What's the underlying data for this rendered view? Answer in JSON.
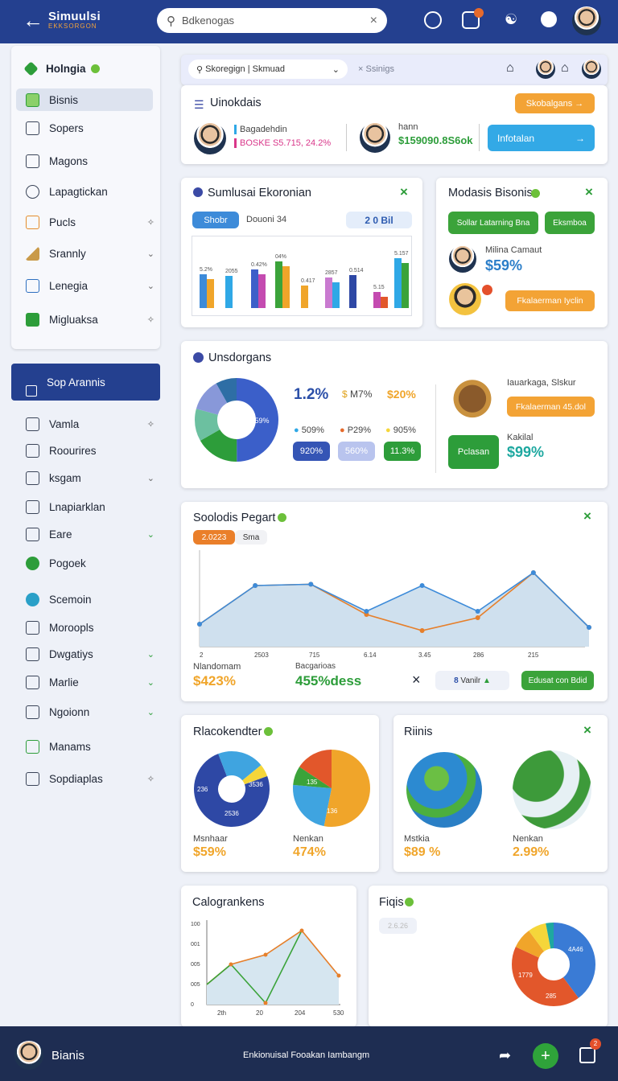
{
  "header": {
    "title": "Simuulsi",
    "subtitle": "EKKSORGON",
    "search_placeholder": "Bdkenogas"
  },
  "sidebar": {
    "items": [
      {
        "label": "Holngia",
        "icon": "diamond-icon"
      },
      {
        "label": "Bisnis",
        "icon": "pencil-icon"
      },
      {
        "label": "Sopers",
        "icon": "book-icon"
      },
      {
        "label": "Magons",
        "icon": "document-icon"
      },
      {
        "label": "Lapagtickan",
        "icon": "clock-icon"
      },
      {
        "label": "Pucls",
        "icon": "chart-icon"
      },
      {
        "label": "Srannly",
        "icon": "warning-icon"
      },
      {
        "label": "Lenegia",
        "icon": "calendar-icon"
      },
      {
        "label": "Migluaksa",
        "icon": "bar-icon"
      }
    ]
  },
  "sidebar2": {
    "active": "Sop Arannis",
    "items": [
      "Vamla",
      "Roourires",
      "ksgam",
      "Lnapiarklan",
      "Eare",
      "Pogoek",
      "Scemoin",
      "Moroopls",
      "Dwgatiys",
      "Marlie",
      "Ngoionn",
      "Manams",
      "Sopdiaplas"
    ]
  },
  "toolbar": {
    "search_text": "Skoregign | Skmuad",
    "filter": "Ssinigs"
  },
  "overview": {
    "title": "Uinokdais",
    "action": "Skobalgans",
    "name1": "Bagadehdin",
    "val1": "BOSKE S5.715, 24.2%",
    "name2": "hann",
    "val2": "$159090.8S6ok",
    "action2": "Infotalan"
  },
  "sim": {
    "title": "Sumlusai Ekoronian",
    "tab1": "Shobr",
    "tab2": "Douoni 34",
    "badge": "2 0 Bil",
    "labels": [
      "5.2%",
      "2055",
      "0.42%",
      "04%",
      "0.417",
      "2857",
      "0.514",
      "5.15",
      "5.157"
    ],
    "values": [
      42,
      40,
      48,
      58,
      28,
      38,
      41,
      20,
      62
    ]
  },
  "model": {
    "title": "Modasis Bisonis",
    "btn1": "Sollar Latarning Bna",
    "btn2": "Eksmboa",
    "person": "Milina Camaut",
    "pct": "$59%",
    "btn3": "Fkalaerman Iyclin"
  },
  "uns": {
    "title": "Unsdorgans",
    "center": "1.559%",
    "v1": "1.2%",
    "v2": "M7%",
    "v3": "$20%",
    "l1": "509%",
    "l2": "P29%",
    "l3": "905%",
    "b1": "920%",
    "b2": "560%",
    "b3": "11.3%",
    "side1": "Iauarkaga, Slskur",
    "btn": "Fkalaerman 45.dol",
    "side2": "Kakilal",
    "btn2": "Pclasan",
    "pct": "$99%"
  },
  "line": {
    "title": "Soolodis Pegart",
    "year": "2.0223",
    "tab2": "Sma",
    "ticks": [
      "2",
      "2503",
      "715",
      "6.14",
      "3.45",
      "286",
      "215"
    ],
    "lab1": "Nlandomam",
    "v1": "$423%",
    "lab2": "Bacgarioas",
    "v2": "455%dess",
    "chip": "Vanilr",
    "btn": "Edusat con Bdid",
    "s1": [
      0.35,
      0.95,
      0.97,
      0.55,
      0.95,
      0.55,
      1.15,
      0.3
    ],
    "s2": [
      0.35,
      0.95,
      0.97,
      0.5,
      0.25,
      0.45,
      1.15,
      0.3
    ]
  },
  "rack": {
    "title": "Rlacokendter",
    "l1": "Msnhaar",
    "v1": "$59%",
    "l2": "Nenkan",
    "v2": "474%",
    "c1": "3536",
    "c2": "2536",
    "c3": "236",
    "c4": "135",
    "c5": "136"
  },
  "riis": {
    "title": "Riinis",
    "l1": "Mstkia",
    "v1": "$89 %",
    "l2": "Nenkan",
    "v2": "2.99%"
  },
  "calo": {
    "title": "Calogrankens",
    "yt": [
      "100",
      "001",
      "005",
      "005",
      "0"
    ],
    "xt": [
      "2th",
      "20",
      "204",
      "530"
    ]
  },
  "faqs": {
    "title": "Fiqis",
    "chip": "2.6.26",
    "c1": "4A46",
    "c2": "1779",
    "c3": "285"
  },
  "bottom": {
    "name": "Bianis",
    "center": "Enkionuisal Fooakan Iambangm",
    "badge": "2"
  }
}
